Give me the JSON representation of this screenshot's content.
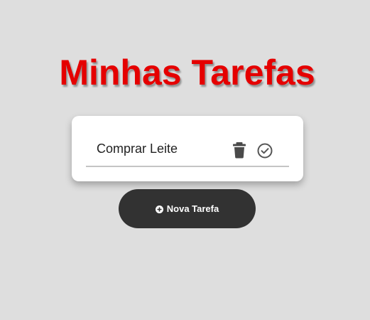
{
  "page": {
    "title": "Minhas Tarefas",
    "background_color": "#dedede",
    "title_color": "#e50000"
  },
  "tasks": [
    {
      "text": "Comprar Leite",
      "actions": {
        "delete_icon": "trash-icon",
        "complete_icon": "check-circle-icon"
      }
    }
  ],
  "new_task_button": {
    "label": "Nova Tarefa",
    "icon": "plus-circle-icon",
    "background_color": "#323232"
  }
}
